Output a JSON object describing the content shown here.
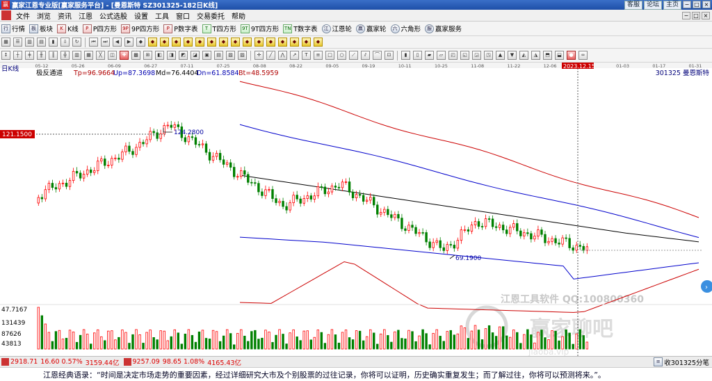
{
  "window": {
    "title": "赢家江恩专业版[赢家服务平台] - [曼恩斯特  SZ301325-182日K线]",
    "links": [
      "客服",
      "论坛",
      "主页"
    ],
    "controls": [
      "−",
      "□",
      "×"
    ]
  },
  "menu": {
    "items": [
      "文件",
      "浏览",
      "资讯",
      "江恩",
      "公式选股",
      "设置",
      "工具",
      "窗口",
      "交易委托",
      "帮助"
    ],
    "mini_controls": [
      "−",
      "□",
      "×"
    ]
  },
  "toolbar1": [
    {
      "icon": "行",
      "label": "行情"
    },
    {
      "icon": "板",
      "label": "板块"
    },
    {
      "icon": "K",
      "label": "K线"
    },
    {
      "icon": "P",
      "label": "P四方形"
    },
    {
      "icon": "9P",
      "label": "9P四方形"
    },
    {
      "icon": "P",
      "label": "P数字表"
    },
    {
      "icon": "T",
      "label": "T四方形"
    },
    {
      "icon": "9T",
      "label": "9T四方形"
    },
    {
      "icon": "TN",
      "label": "T数字表"
    },
    {
      "icon": "江",
      "label": "江恩轮"
    },
    {
      "icon": "赢",
      "label": "赢家轮"
    },
    {
      "icon": "六",
      "label": "六角形"
    },
    {
      "icon": "服",
      "label": "赢家服务"
    }
  ],
  "chart": {
    "panel_label": "日K线",
    "indicator": {
      "name": "极反通道",
      "tp": "Tp=96.9664",
      "up": "Up=87.3698",
      "md": "Md=76.4404",
      "dn": "Dn=61.8584",
      "bt": "Bt=48.5959"
    },
    "symbol_label": "301325  曼恩斯特",
    "dates": [
      "05-12",
      "05-26",
      "06-09",
      "06-27",
      "07-11",
      "07-25",
      "08-08",
      "08-22",
      "09-05",
      "09-19",
      "10-11",
      "10-25",
      "11-08",
      "11-22",
      "12-06",
      "2023.12.15",
      "01-03",
      "01-17",
      "01-31"
    ],
    "cursor_date": "2023.12.15",
    "cursor_price": "121.1500",
    "high_label": "124.2800",
    "low_label": "69.1900",
    "volume_axis": [
      "47.7167",
      "131439",
      "87626",
      "43813"
    ],
    "watermark_text": "江恩工具软件  QQ:100800360",
    "watermark_logo": "赢家聊吧",
    "watermark_url": "jiaoba.vip",
    "colors": {
      "up": "#ff0000",
      "down": "#008000",
      "upper_band": "#cc0000",
      "mid_band": "#0000cc",
      "center": "#000000",
      "cursor_box": "#cc0000"
    }
  },
  "status": {
    "index1": "2918.71",
    "index1_change": "16.60  0.57%",
    "index1_amount": "3159.44亿",
    "index2": "9257.09",
    "index2_change": "98.65  1.08%",
    "index2_amount": "4165.43亿",
    "right_text": "收301325分笔"
  },
  "quote": {
    "text": "江恩经典语录：“时间是决定市场走势的重要因素，经过详细研究大市及个别股票的过往记录，你将可以证明，历史确实重复发生；而了解过往，你将可以预测将来。”。"
  }
}
